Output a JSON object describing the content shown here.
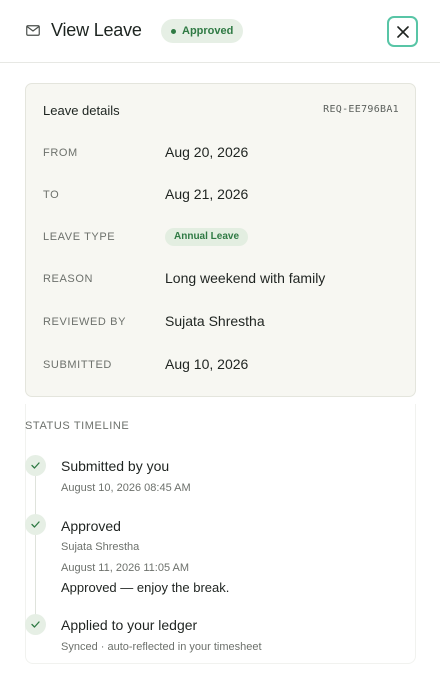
{
  "header": {
    "title": "View Leave",
    "status": "Approved",
    "icons": {
      "leading": "mail-icon",
      "close": "close-icon"
    }
  },
  "details": {
    "title": "Leave details",
    "reference": "REQ-EE796BA1",
    "rows": [
      {
        "label": "FROM",
        "value": "Aug 20, 2026"
      },
      {
        "label": "TO",
        "value": "Aug 21, 2026"
      },
      {
        "label": "LEAVE TYPE",
        "value": "Annual Leave"
      },
      {
        "label": "REASON",
        "value": "Long weekend with family"
      },
      {
        "label": "REVIEWED BY",
        "value": "Sujata Shrestha"
      },
      {
        "label": "SUBMITTED",
        "value": "Aug 10, 2026"
      }
    ]
  },
  "timeline": {
    "heading": "STATUS TIMELINE",
    "events": [
      {
        "title": "Submitted by you",
        "meta": "August 10, 2026 08:45 AM"
      },
      {
        "title": "Approved",
        "by": "Sujata Shrestha",
        "meta": "August 11, 2026 11:05 AM",
        "note": "Approved — enjoy the break."
      },
      {
        "title": "Applied to your ledger",
        "meta": "Synced · auto-reflected in your timesheet"
      }
    ]
  },
  "colors": {
    "accent": "#2f7a44",
    "badge_bg": "#e6efe5",
    "close_border": "#58c5a6",
    "card_bg": "#f7f7f2"
  }
}
